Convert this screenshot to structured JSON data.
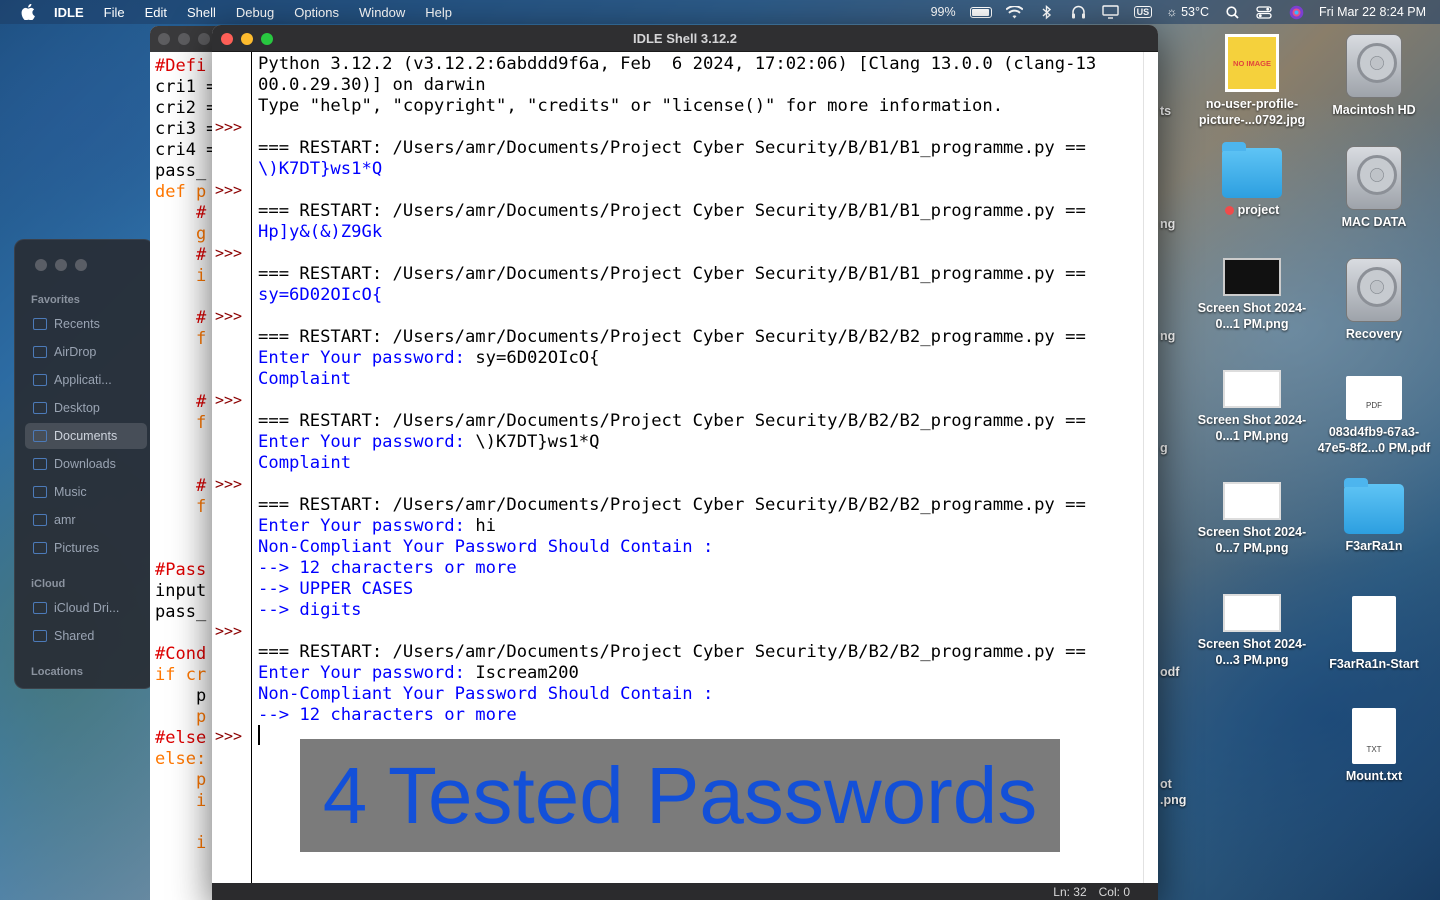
{
  "menubar": {
    "app_name": "IDLE",
    "items": [
      "File",
      "Edit",
      "Shell",
      "Debug",
      "Options",
      "Window",
      "Help"
    ],
    "battery": "99%",
    "input_source": "US",
    "weather": "53°C",
    "clock": "Fri Mar 22  8:24 PM"
  },
  "finder": {
    "favorites_header": "Favorites",
    "favorites": [
      "Recents",
      "AirDrop",
      "Applicati...",
      "Desktop",
      "Documents",
      "Downloads",
      "Music",
      "amr",
      "Pictures"
    ],
    "selected": "Documents",
    "icloud_header": "iCloud",
    "icloud": [
      "iCloud Dri...",
      "Shared"
    ],
    "locations_header": "Locations"
  },
  "editor": {
    "lines": [
      {
        "t": "#Defi",
        "c": "cm"
      },
      {
        "t": "cri1 =",
        "c": "bk"
      },
      {
        "t": "cri2 =",
        "c": "bk"
      },
      {
        "t": "cri3 =",
        "c": "bk"
      },
      {
        "t": "cri4 =",
        "c": "bk"
      },
      {
        "t": "pass_",
        "c": "bk"
      },
      {
        "t": "def p",
        "c": "kw"
      },
      {
        "t": "    #",
        "c": "cm"
      },
      {
        "t": "    g",
        "c": "kw"
      },
      {
        "t": "    #",
        "c": "cm"
      },
      {
        "t": "    i",
        "c": "kw"
      },
      {
        "t": "",
        "c": "bk"
      },
      {
        "t": "    #",
        "c": "cm"
      },
      {
        "t": "    f",
        "c": "kw"
      },
      {
        "t": "",
        "c": "bk"
      },
      {
        "t": "",
        "c": "bk"
      },
      {
        "t": "    #",
        "c": "cm"
      },
      {
        "t": "    f",
        "c": "kw"
      },
      {
        "t": "",
        "c": "bk"
      },
      {
        "t": "",
        "c": "bk"
      },
      {
        "t": "    #",
        "c": "cm"
      },
      {
        "t": "    f",
        "c": "kw"
      },
      {
        "t": "",
        "c": "bk"
      },
      {
        "t": "",
        "c": "bk"
      },
      {
        "t": "#Pass",
        "c": "cm"
      },
      {
        "t": "input",
        "c": "bk"
      },
      {
        "t": "pass_",
        "c": "bk"
      },
      {
        "t": "",
        "c": "bk"
      },
      {
        "t": "#Cond",
        "c": "cm"
      },
      {
        "t": "if cr",
        "c": "kw"
      },
      {
        "t": "    p",
        "c": "bk"
      },
      {
        "t": "    p",
        "c": "kw"
      },
      {
        "t": "#else",
        "c": "cm"
      },
      {
        "t": "else:",
        "c": "kw"
      },
      {
        "t": "    p",
        "c": "kw"
      },
      {
        "t": "    i",
        "c": "kw"
      },
      {
        "t": "",
        "c": "bk"
      },
      {
        "t": "    i",
        "c": "kw"
      }
    ]
  },
  "shell": {
    "title": "IDLE Shell 3.12.2",
    "prompt": ">>>",
    "prompt_rows": [
      3,
      6,
      9,
      12,
      16,
      20,
      27,
      32
    ],
    "lines": [
      {
        "t": "Python 3.12.2 (v3.12.2:6abddd9f6a, Feb  6 2024, 17:02:06) [Clang 13.0.0 (clang-13",
        "c": "o"
      },
      {
        "t": "00.0.29.30)] on darwin",
        "c": "o"
      },
      {
        "t": "Type \"help\", \"copyright\", \"credits\" or \"license()\" for more information.",
        "c": "o"
      },
      {
        "t": "",
        "c": "o"
      },
      {
        "t": "=== RESTART: /Users/amr/Documents/Project Cyber Security/B/B1/B1_programme.py ==",
        "c": "o"
      },
      {
        "t": "\\)K7DT}ws1*Q",
        "c": "b"
      },
      {
        "t": "",
        "c": "o"
      },
      {
        "t": "=== RESTART: /Users/amr/Documents/Project Cyber Security/B/B1/B1_programme.py ==",
        "c": "o"
      },
      {
        "t": "Hp]y&(&)Z9Gk",
        "c": "b"
      },
      {
        "t": "",
        "c": "o"
      },
      {
        "t": "=== RESTART: /Users/amr/Documents/Project Cyber Security/B/B1/B1_programme.py ==",
        "c": "o"
      },
      {
        "t": "sy=6D02OIcO{",
        "c": "b"
      },
      {
        "t": "",
        "c": "o"
      },
      {
        "t": "=== RESTART: /Users/amr/Documents/Project Cyber Security/B/B2/B2_programme.py ==",
        "c": "o"
      },
      {
        "t": "Enter Your password: ",
        "c": "b",
        "input": "sy=6D02OIcO{"
      },
      {
        "t": "Complaint",
        "c": "b"
      },
      {
        "t": "",
        "c": "o"
      },
      {
        "t": "=== RESTART: /Users/amr/Documents/Project Cyber Security/B/B2/B2_programme.py ==",
        "c": "o"
      },
      {
        "t": "Enter Your password: ",
        "c": "b",
        "input": "\\)K7DT}ws1*Q"
      },
      {
        "t": "Complaint",
        "c": "b"
      },
      {
        "t": "",
        "c": "o"
      },
      {
        "t": "=== RESTART: /Users/amr/Documents/Project Cyber Security/B/B2/B2_programme.py ==",
        "c": "o"
      },
      {
        "t": "Enter Your password: ",
        "c": "b",
        "input": "hi"
      },
      {
        "t": "Non-Compliant Your Password Should Contain :",
        "c": "b"
      },
      {
        "t": "--> 12 characters or more",
        "c": "b"
      },
      {
        "t": "--> UPPER CASES",
        "c": "b"
      },
      {
        "t": "--> digits",
        "c": "b"
      },
      {
        "t": "",
        "c": "o"
      },
      {
        "t": "=== RESTART: /Users/amr/Documents/Project Cyber Security/B/B2/B2_programme.py ==",
        "c": "o"
      },
      {
        "t": "Enter Your password: ",
        "c": "b",
        "input": "Iscream200"
      },
      {
        "t": "Non-Compliant Your Password Should Contain :",
        "c": "b"
      },
      {
        "t": "--> 12 characters or more",
        "c": "b"
      }
    ],
    "status": {
      "line": "Ln: 32",
      "col": "Col: 0"
    }
  },
  "overlay": {
    "text": "4 Tested Passwords"
  },
  "desktop": {
    "icons": [
      {
        "name": "no-user-profile-picture-...0792.jpg",
        "kind": "noimg",
        "art_text": "NO IMAGE"
      },
      {
        "name": "Macintosh HD",
        "kind": "hdd"
      },
      {
        "name": "project",
        "kind": "folder",
        "tag": "red"
      },
      {
        "name": "MAC DATA",
        "kind": "hdd"
      },
      {
        "name": "Screen Shot 2024-0...1 PM.png",
        "kind": "thumb-dark"
      },
      {
        "name": "Recovery",
        "kind": "hdd"
      },
      {
        "name": "Screen Shot 2024-0...1 PM.png",
        "kind": "thumb"
      },
      {
        "name": "083d4fb9-67a3-47e5-8f2...0 PM.pdf",
        "kind": "pdf",
        "art_text": "PDF"
      },
      {
        "name": "Screen Shot 2024-0...7 PM.png",
        "kind": "thumb"
      },
      {
        "name": "F3arRa1n",
        "kind": "folder"
      },
      {
        "name": "Screen Shot 2024-0...3 PM.png",
        "kind": "thumb"
      },
      {
        "name": "F3arRa1n-Start",
        "kind": "doc"
      },
      {
        "name": "Mount.txt",
        "kind": "txt",
        "art_text": "TXT"
      }
    ],
    "partial_labels": [
      "ts",
      "ng",
      "ng",
      "g",
      "odf",
      "ot",
      ".png"
    ]
  }
}
